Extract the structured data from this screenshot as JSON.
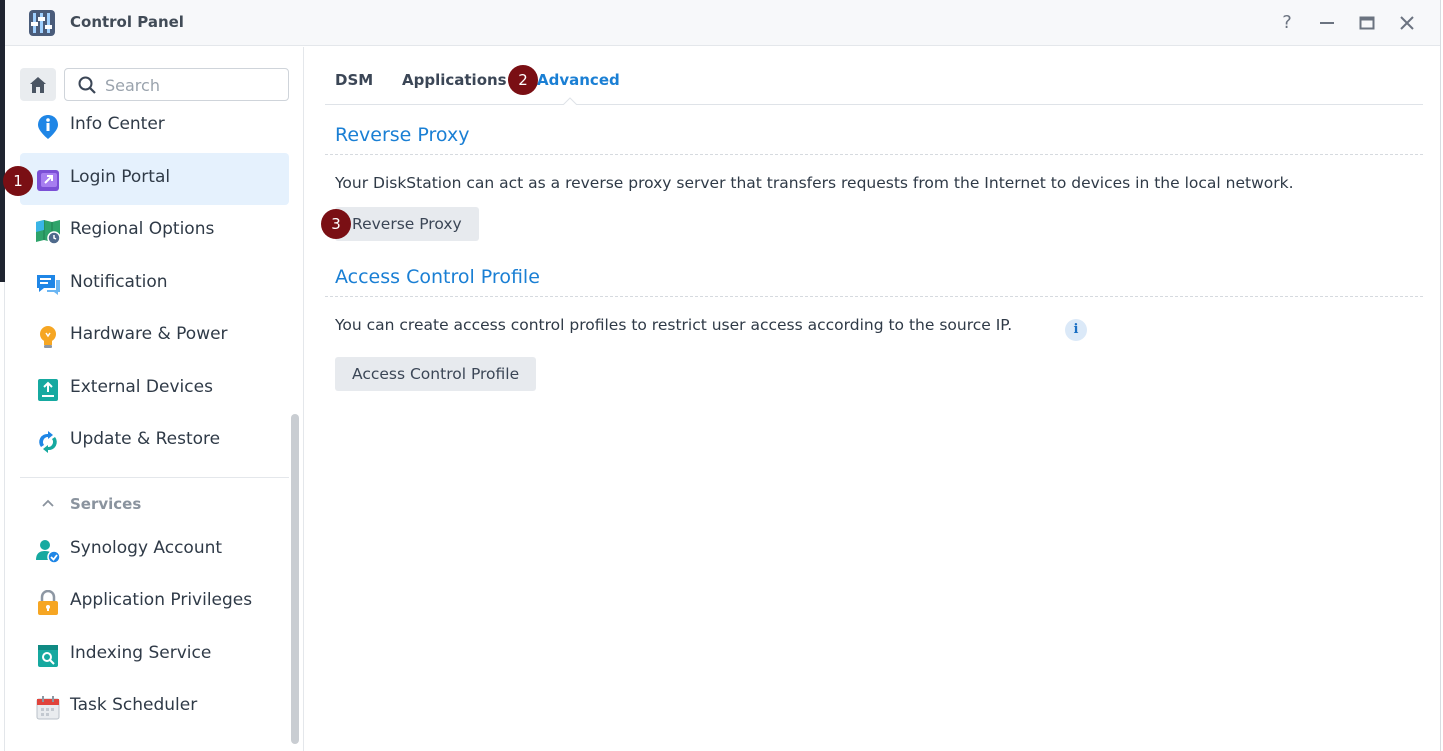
{
  "window": {
    "title": "Control Panel",
    "controls": [
      "?",
      "—",
      "▭",
      "✕"
    ]
  },
  "sidebar": {
    "search_placeholder": "Search",
    "items": [
      {
        "label": "Info Center",
        "icon": "info-center-icon"
      },
      {
        "label": "Login Portal",
        "icon": "login-portal-icon",
        "active": true
      },
      {
        "label": "Regional Options",
        "icon": "regional-options-icon"
      },
      {
        "label": "Notification",
        "icon": "notification-icon"
      },
      {
        "label": "Hardware & Power",
        "icon": "hardware-power-icon"
      },
      {
        "label": "External Devices",
        "icon": "external-devices-icon"
      },
      {
        "label": "Update & Restore",
        "icon": "update-restore-icon"
      }
    ],
    "services_header": "Services",
    "services": [
      {
        "label": "Synology Account",
        "icon": "synology-account-icon"
      },
      {
        "label": "Application Privileges",
        "icon": "application-privileges-icon"
      },
      {
        "label": "Indexing Service",
        "icon": "indexing-service-icon"
      },
      {
        "label": "Task Scheduler",
        "icon": "task-scheduler-icon"
      }
    ]
  },
  "tabs": [
    {
      "label": "DSM"
    },
    {
      "label": "Applications"
    },
    {
      "label": "Advanced",
      "active": true
    }
  ],
  "content": {
    "reverse_proxy": {
      "title": "Reverse Proxy",
      "description": "Your DiskStation can act as a reverse proxy server that transfers requests from the Internet to devices in the local network.",
      "button": "Reverse Proxy"
    },
    "access_control": {
      "title": "Access Control Profile",
      "description": "You can create access control profiles to restrict user access according to the source IP.",
      "info": "i",
      "button": "Access Control Profile"
    }
  },
  "markers": [
    "1",
    "2",
    "3"
  ],
  "colors": {
    "accent": "#1a7fd4",
    "active_bg": "#e5f1fd",
    "marker": "#7a0f14"
  }
}
